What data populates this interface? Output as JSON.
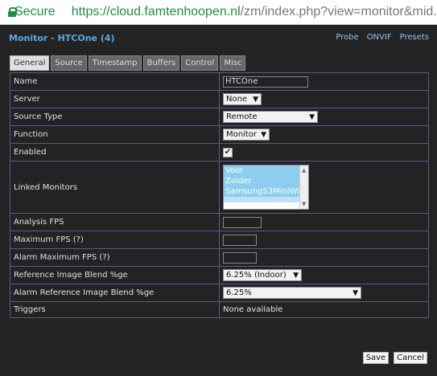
{
  "browser": {
    "secure_label": "Secure",
    "url_host": "https://cloud.famtenhoopen.nl",
    "url_path": "/zm/index.php?view=monitor&mid..."
  },
  "header": {
    "title": "Monitor - HTCOne (4)",
    "links": [
      "Probe",
      "ONVIF",
      "Presets"
    ]
  },
  "tabs": [
    "General",
    "Source",
    "Timestamp",
    "Buffers",
    "Control",
    "Misc"
  ],
  "form": {
    "name": {
      "label": "Name",
      "value": "HTCOne"
    },
    "server": {
      "label": "Server",
      "value": "None"
    },
    "source_type": {
      "label": "Source Type",
      "value": "Remote"
    },
    "function": {
      "label": "Function",
      "value": "Monitor"
    },
    "enabled": {
      "label": "Enabled",
      "checked": true
    },
    "linked_monitors": {
      "label": "Linked Monitors",
      "options": [
        "Voor",
        "Zolder",
        "SamsungS3MiniWit"
      ]
    },
    "analysis_fps": {
      "label": "Analysis FPS",
      "value": ""
    },
    "maximum_fps": {
      "label": "Maximum FPS (?)",
      "value": ""
    },
    "alarm_maximum_fps": {
      "label": "Alarm Maximum FPS (?)",
      "value": ""
    },
    "reference_blend": {
      "label": "Reference Image Blend %ge",
      "value": "6.25% (Indoor)"
    },
    "alarm_reference_blend": {
      "label": "Alarm Reference Image Blend %ge",
      "value": "6.25%"
    },
    "triggers": {
      "label": "Triggers",
      "value": "None available"
    }
  },
  "buttons": {
    "save": "Save",
    "cancel": "Cancel"
  }
}
